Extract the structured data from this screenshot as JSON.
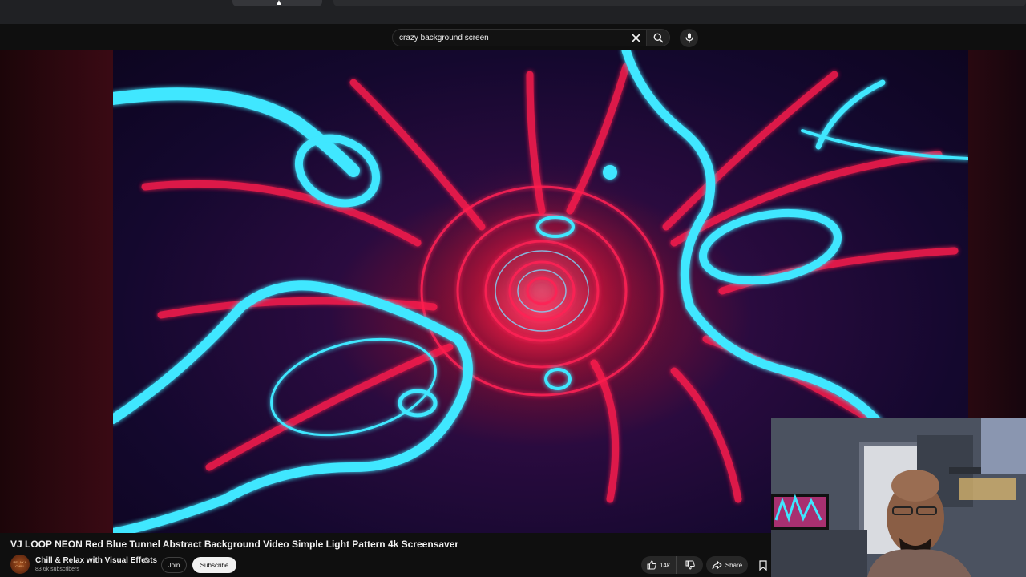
{
  "search": {
    "query": "crazy background screen"
  },
  "video": {
    "title": "VJ LOOP NEON Red Blue Tunnel Abstract Background Video Simple Light Pattern 4k Screensaver"
  },
  "channel": {
    "name": "Chill & Relax with Visual Effects",
    "subscribers": "83.6k subscribers",
    "avatar_text": "RELAX & CHILL",
    "verified_icon": "verified-check-icon"
  },
  "actions": {
    "join_label": "Join",
    "subscribe_label": "Subscribe",
    "like_count": "14k",
    "share_label": "Share"
  },
  "icons": {
    "clear": "close-icon",
    "search": "search-icon",
    "mic": "mic-icon",
    "like": "thumbs-up-icon",
    "dislike": "thumbs-down-icon",
    "share": "share-arrow-icon",
    "save": "bookmark-icon"
  },
  "colors": {
    "neon_cyan": "#3fe7ff",
    "neon_red": "#ff2255",
    "subscribe_bg": "#f1f1f1",
    "page_bg": "#0f0f0f"
  }
}
